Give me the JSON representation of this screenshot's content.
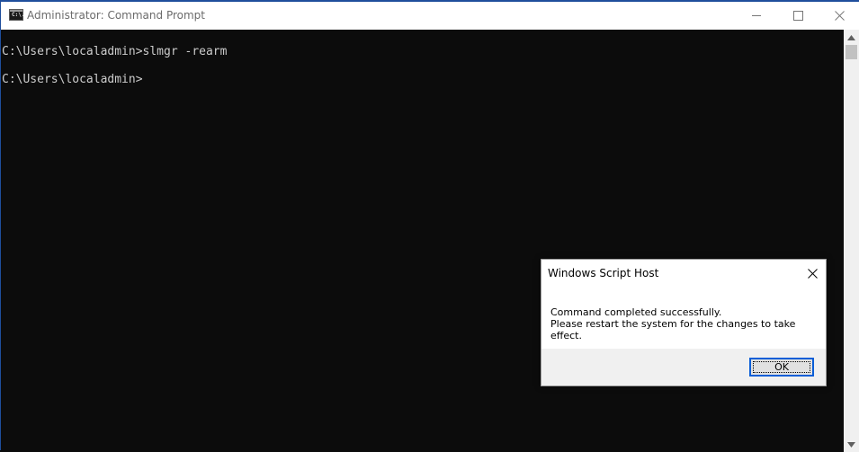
{
  "window": {
    "title": "Administrator: Command Prompt",
    "icon": "cmd-icon",
    "icon_text": "C:\\."
  },
  "console": {
    "lines": [
      "C:\\Users\\localadmin>slmgr -rearm",
      "C:\\Users\\localadmin>"
    ]
  },
  "dialog": {
    "title": "Windows Script Host",
    "message_line1": "Command completed successfully.",
    "message_line2": "Please restart the system for the changes to take effect.",
    "ok_label": "OK"
  },
  "colors": {
    "console_bg": "#0c0c0c",
    "console_text": "#cccccc",
    "accent": "#0a5ed7"
  }
}
